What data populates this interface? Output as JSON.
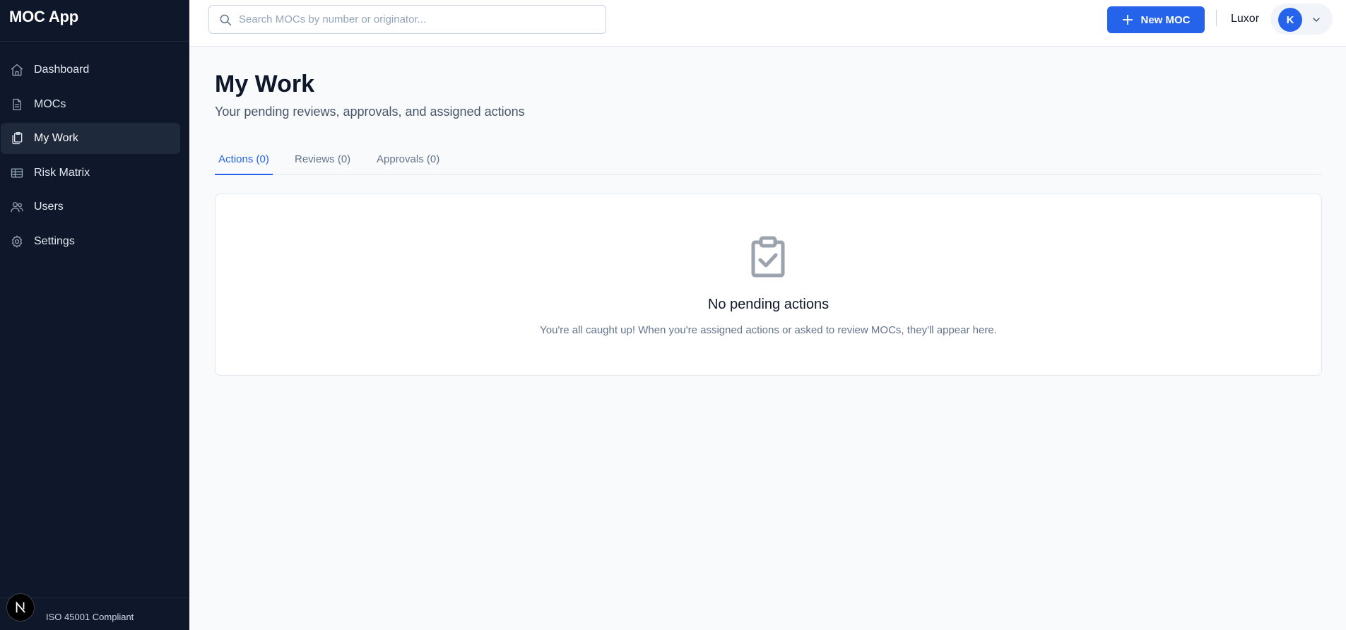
{
  "app": {
    "title": "MOC App"
  },
  "sidebar": {
    "items": [
      {
        "label": "Dashboard",
        "icon": "home-icon"
      },
      {
        "label": "MOCs",
        "icon": "document-icon"
      },
      {
        "label": "My Work",
        "icon": "clipboard-copy-icon",
        "active": true
      },
      {
        "label": "Risk Matrix",
        "icon": "table-icon"
      },
      {
        "label": "Users",
        "icon": "users-icon"
      },
      {
        "label": "Settings",
        "icon": "gear-icon"
      }
    ],
    "footer": {
      "compliance": "ISO 45001 Compliant",
      "badge_letter": "N"
    }
  },
  "header": {
    "search": {
      "placeholder": "Search MOCs by number or originator...",
      "value": ""
    },
    "new_button_label": "New MOC",
    "user_name": "Luxor",
    "avatar_initial": "K"
  },
  "page": {
    "title": "My Work",
    "subtitle": "Your pending reviews, approvals, and assigned actions"
  },
  "tabs": [
    {
      "label": "Actions (0)",
      "active": true
    },
    {
      "label": "Reviews (0)",
      "active": false
    },
    {
      "label": "Approvals (0)",
      "active": false
    }
  ],
  "empty_state": {
    "icon": "clipboard-check-icon",
    "title": "No pending actions",
    "message": "You're all caught up! When you're assigned actions or asked to review MOCs, they'll appear here."
  },
  "colors": {
    "sidebar_bg": "#0f172a",
    "accent": "#2563eb",
    "page_bg": "#f8fafc"
  }
}
